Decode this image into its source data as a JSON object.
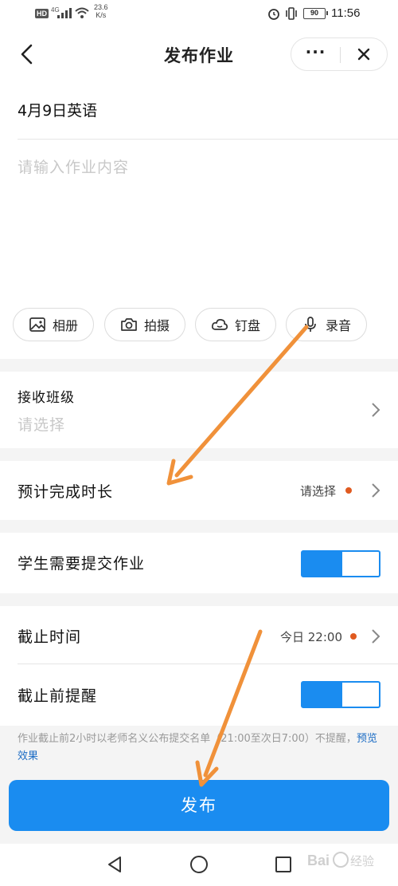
{
  "status_bar": {
    "hd": "HD",
    "net": "4G",
    "speed_value": "23.6",
    "speed_unit": "K/s",
    "battery": "90",
    "time": "11:56"
  },
  "header": {
    "title": "发布作业",
    "more_label": "···"
  },
  "editor": {
    "title_value": "4月9日英语",
    "content_placeholder": "请输入作业内容",
    "tools": [
      {
        "label": "相册",
        "icon": "image-icon"
      },
      {
        "label": "拍摄",
        "icon": "camera-icon"
      },
      {
        "label": "钉盘",
        "icon": "cloud-drive-icon"
      },
      {
        "label": "录音",
        "icon": "microphone-icon"
      }
    ]
  },
  "receive_class": {
    "label": "接收班级",
    "placeholder": "请选择"
  },
  "duration": {
    "label": "预计完成时长",
    "value": "请选择"
  },
  "submit_required": {
    "label": "学生需要提交作业",
    "enabled": true
  },
  "deadline": {
    "label": "截止时间",
    "value": "今日 22:00"
  },
  "reminder": {
    "label": "截止前提醒",
    "enabled": true
  },
  "note": {
    "text": "作业截止前2小时以老师名义公布提交名单（21:00至次日7:00）不提醒，",
    "link": "预览效果"
  },
  "publish_label": "发布",
  "colors": {
    "primary": "#1a8cf0",
    "alert_dot": "#e05a20",
    "arrow": "#f0913a"
  }
}
